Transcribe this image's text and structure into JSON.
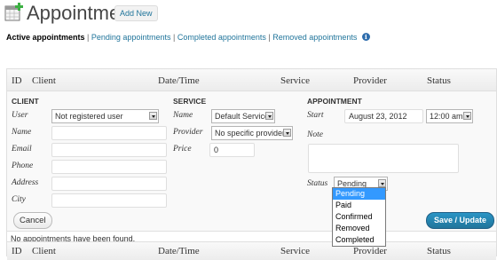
{
  "header": {
    "title": "Appointments",
    "add_new_label": "Add New",
    "icon": "calendar-add-icon"
  },
  "subnav": {
    "current": "Active appointments",
    "links": [
      "Pending appointments",
      "Completed appointments",
      "Removed appointments"
    ],
    "separator": "|",
    "info_icon": "info-icon",
    "info_glyph": "i"
  },
  "table": {
    "columns": [
      "ID",
      "Client",
      "Date/Time",
      "Service",
      "Provider",
      "Status"
    ],
    "empty_message": "No appointments have been found."
  },
  "editor": {
    "client": {
      "title": "CLIENT",
      "user_label": "User",
      "user_value": "Not registered user",
      "name_label": "Name",
      "name_value": "",
      "email_label": "Email",
      "email_value": "",
      "phone_label": "Phone",
      "phone_value": "",
      "address_label": "Address",
      "address_value": "",
      "city_label": "City",
      "city_value": ""
    },
    "service": {
      "title": "SERVICE",
      "name_label": "Name",
      "name_value": "Default Service",
      "provider_label": "Provider",
      "provider_value": "No specific provider",
      "price_label": "Price",
      "price_value": "0"
    },
    "appointment": {
      "title": "APPOINTMENT",
      "start_label": "Start",
      "start_date": "August 23, 2012",
      "start_time": "12:00 am",
      "note_label": "Note",
      "note_value": "",
      "status_label": "Status",
      "status_value": "Pending",
      "status_options": [
        "Pending",
        "Paid",
        "Confirmed",
        "Removed",
        "Completed"
      ]
    },
    "cancel_label": "Cancel",
    "save_label": "Save / Update"
  },
  "colors": {
    "link": "#21759b",
    "primary_button": "#21759b",
    "dropdown_highlight": "#3399ff"
  }
}
